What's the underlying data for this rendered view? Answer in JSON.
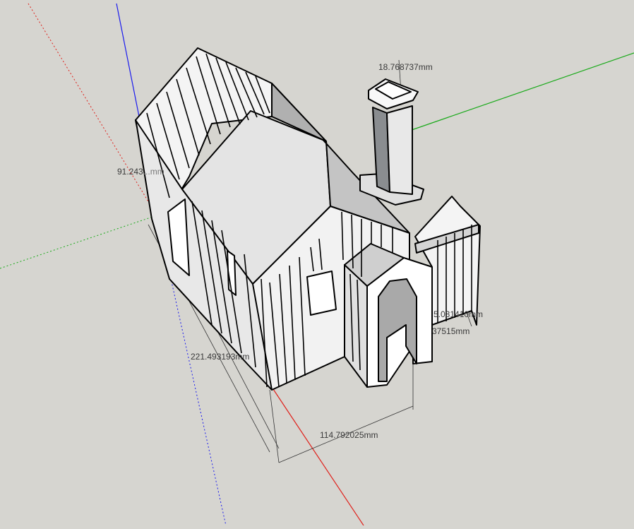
{
  "colors": {
    "background": "#d6d5d0",
    "axis_red": "#e0201a",
    "axis_green": "#1aaa1a",
    "axis_blue": "#1a1aee",
    "model_line": "#000000",
    "face_light": "#ffffff",
    "face_shade": "#b8b8b8",
    "face_dark": "#8a8d90"
  },
  "dimensions": {
    "chimney_top": "18.768737mm",
    "wall_height": "91.243",
    "wall_height_hidden": "...mm",
    "left_length": "221.493193mm",
    "front_width": "114.792025mm",
    "fence_offset": "5.031410mm",
    "fence_offset_2": "37515mm"
  },
  "icons": {
    "axes": "axes-icon",
    "model": "house-model-icon"
  }
}
